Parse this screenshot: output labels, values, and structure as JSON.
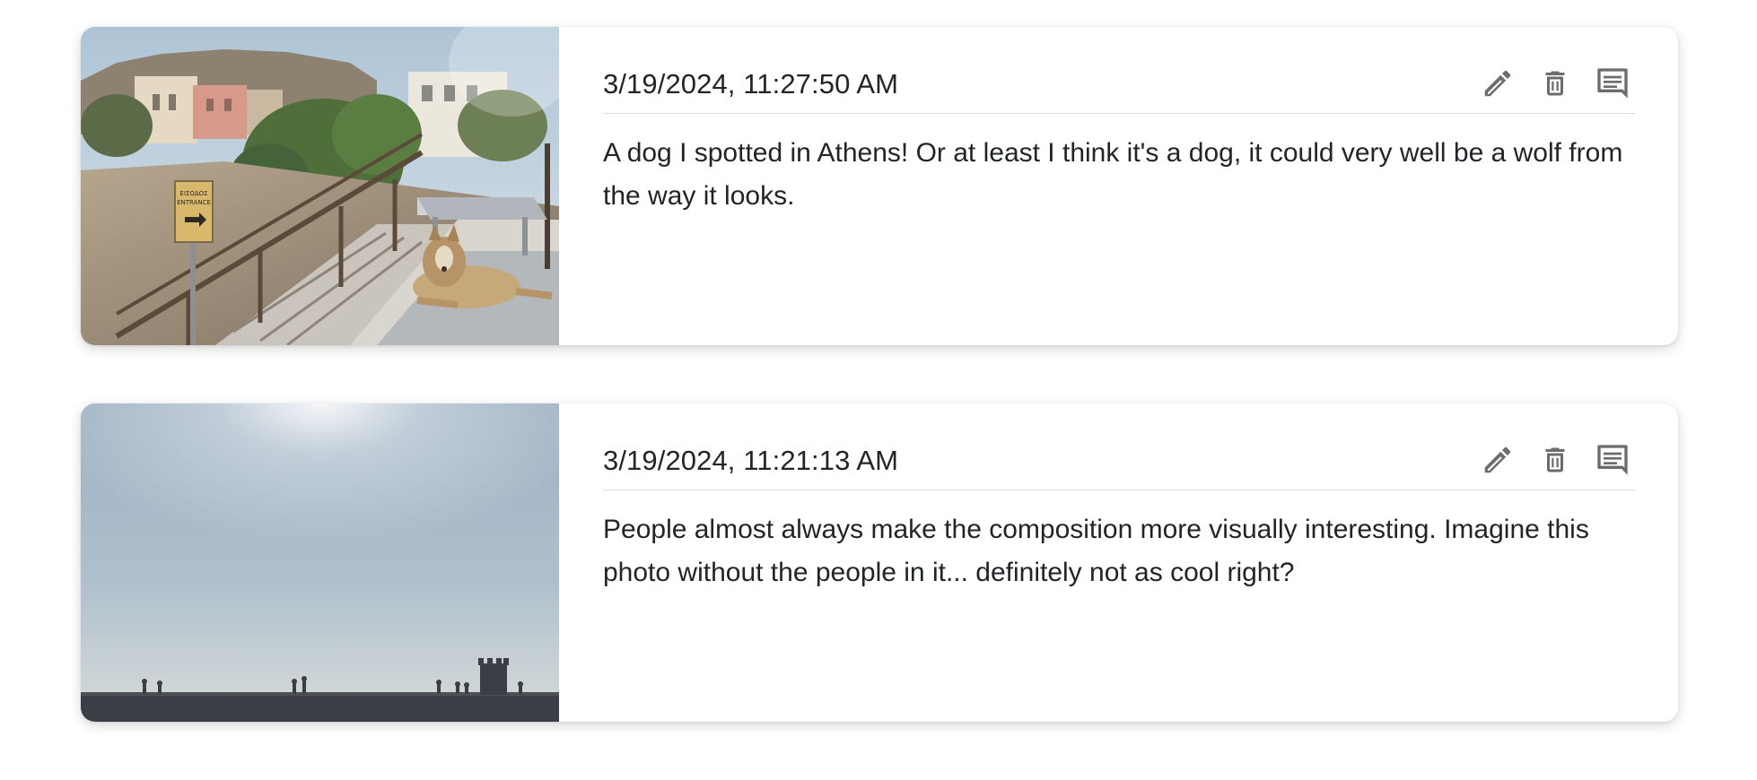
{
  "posts": [
    {
      "timestamp": "3/19/2024, 11:27:50 AM",
      "text": "A dog I spotted in Athens! Or at least I think it's a dog, it could very well be a wolf from the way it looks.",
      "photo_sign_text": [
        "ΕΙΣΟΔΟΣ",
        "ENTRANCE"
      ],
      "actions": [
        {
          "icon": "pencil-icon",
          "name": "edit"
        },
        {
          "icon": "trash-icon",
          "name": "delete"
        },
        {
          "icon": "comment-icon",
          "name": "comment"
        }
      ]
    },
    {
      "timestamp": "3/19/2024, 11:21:13 AM",
      "text": "People almost always make the composition more visually interesting. Imagine this photo without the people in it... definitely not as cool right?",
      "actions": [
        {
          "icon": "pencil-icon",
          "name": "edit"
        },
        {
          "icon": "trash-icon",
          "name": "delete"
        },
        {
          "icon": "comment-icon",
          "name": "comment"
        }
      ]
    }
  ],
  "colors": {
    "text": "#212529",
    "icon": "#6c6c6c",
    "divider": "#dcdcdc"
  }
}
